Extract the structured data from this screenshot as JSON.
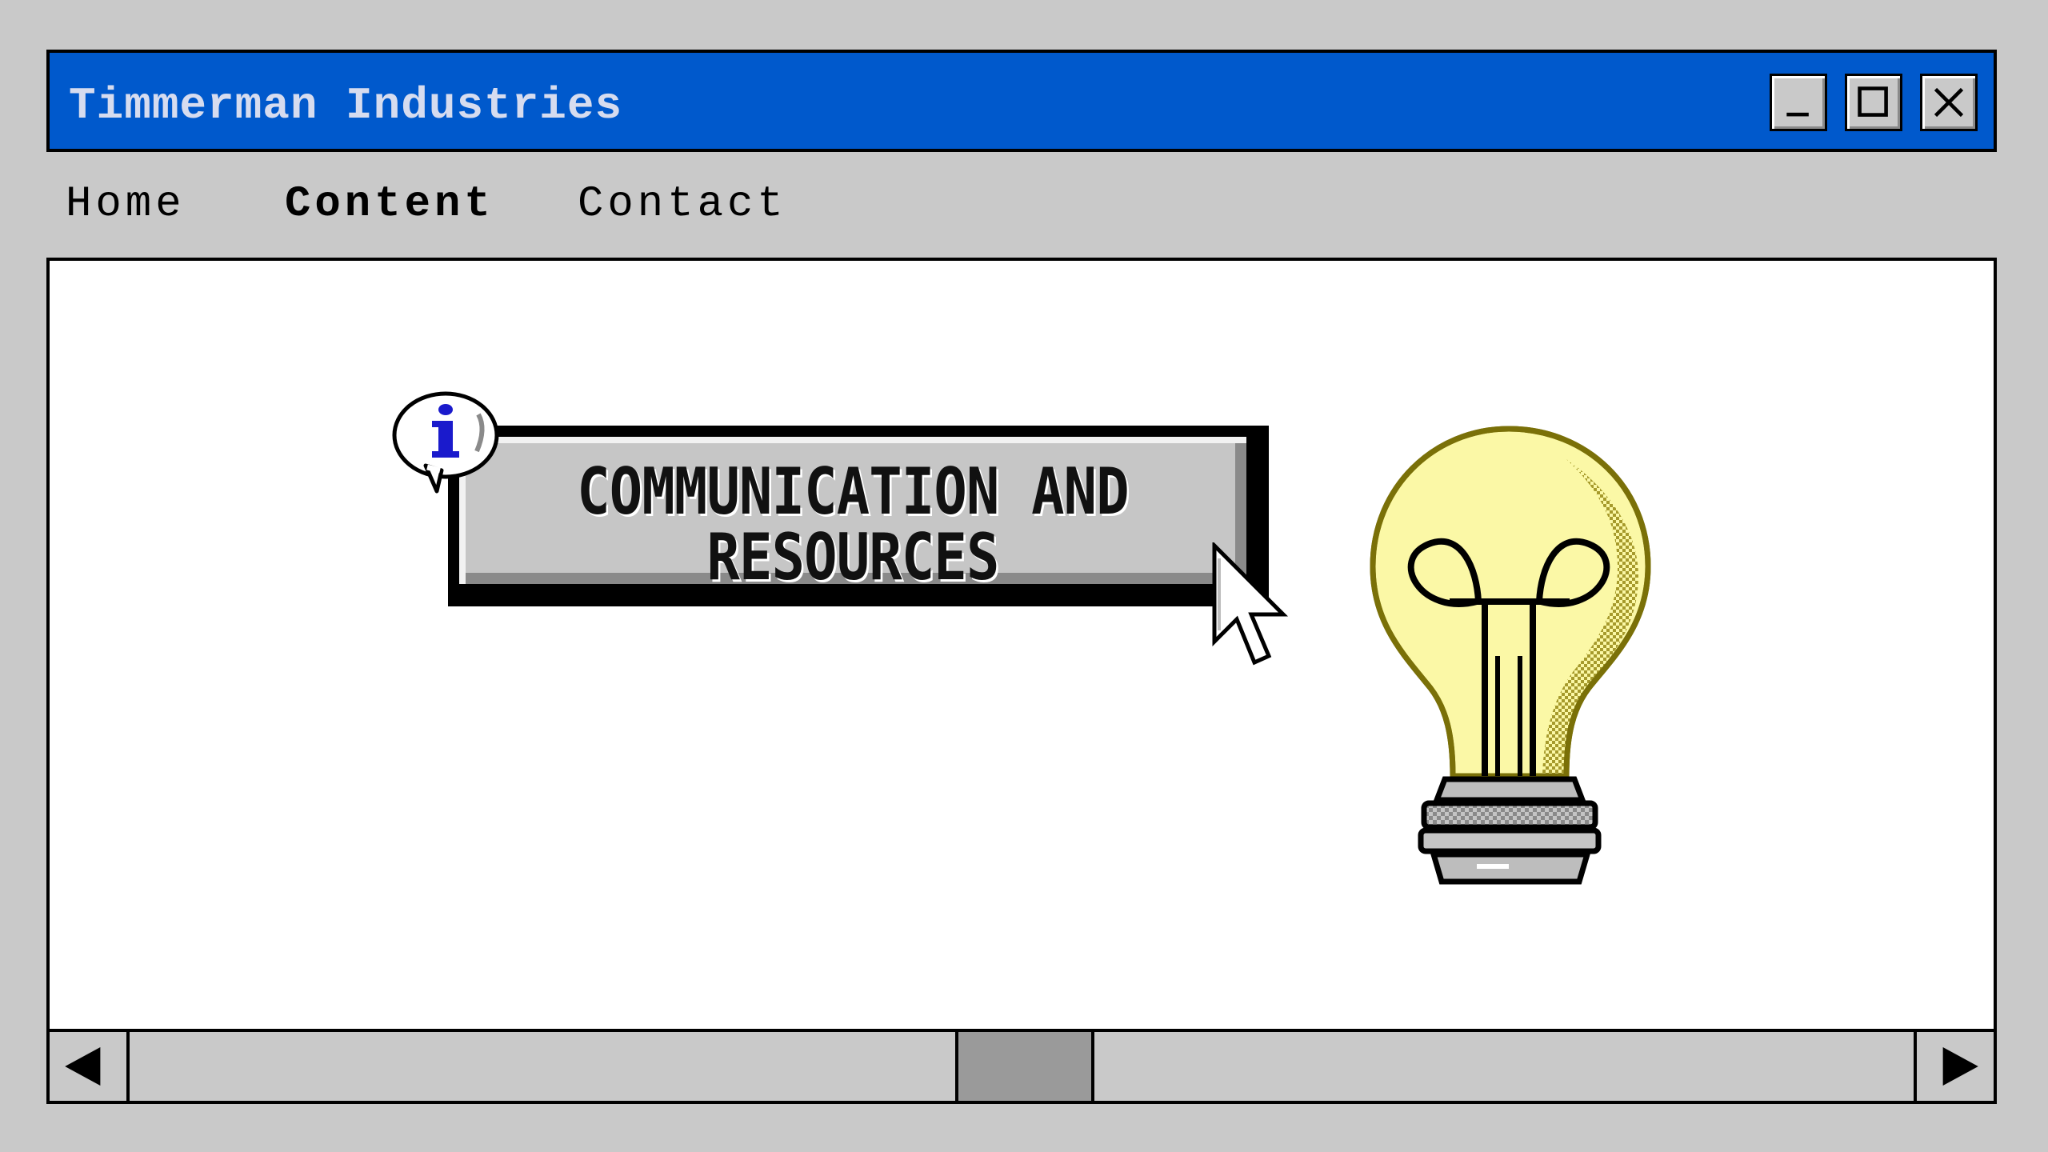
{
  "window": {
    "title": "Timmerman Industries",
    "controls": [
      "minimize",
      "maximize",
      "close"
    ]
  },
  "menu": {
    "items": [
      {
        "label": "Home",
        "active": false
      },
      {
        "label": "Content",
        "active": true
      },
      {
        "label": "Contact",
        "active": false
      }
    ]
  },
  "main": {
    "button_line1": "COMMUNICATION AND",
    "button_line2": "RESOURCES",
    "icons": [
      "info-icon",
      "arrow-cursor-icon",
      "light-bulb-icon"
    ]
  },
  "scrollbar": {
    "left_arrow": "left-arrow-icon",
    "right_arrow": "right-arrow-icon"
  },
  "colors": {
    "titlebar": "#0059cc",
    "title_text": "#d6dcef",
    "background": "#c9c9c9",
    "content_bg": "#ffffff",
    "bulb_glass": "#fbf8a6",
    "info_accent": "#1a1acc"
  }
}
